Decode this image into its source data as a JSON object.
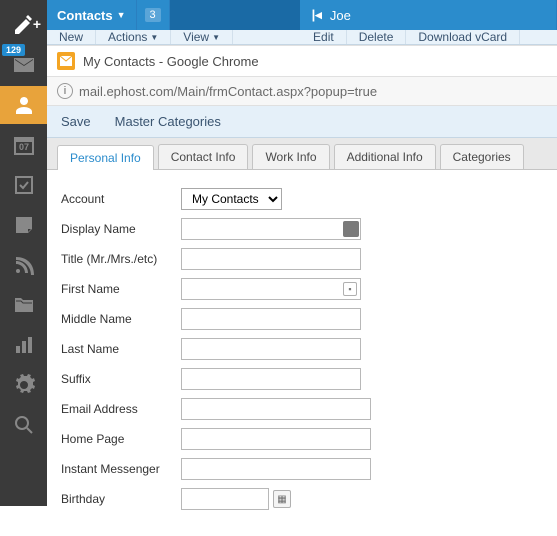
{
  "rail": {
    "mail_badge": "129",
    "calendar_day": "07"
  },
  "header": {
    "tab_contacts": "Contacts",
    "tab_count": "3",
    "tab_person": "Joe"
  },
  "toolbar_left": {
    "new": "New",
    "actions": "Actions",
    "view": "View"
  },
  "toolbar_right": {
    "edit": "Edit",
    "delete": "Delete",
    "download": "Download vCard"
  },
  "popup": {
    "title": "My Contacts - Google Chrome",
    "url": "mail.ephost.com/Main/frmContact.aspx?popup=true",
    "save": "Save",
    "master_categories": "Master Categories",
    "tabs": {
      "personal": "Personal Info",
      "contact": "Contact Info",
      "work": "Work Info",
      "additional": "Additional Info",
      "categories": "Categories"
    },
    "form": {
      "account_label": "Account",
      "account_value": "My Contacts",
      "display_name_label": "Display Name",
      "title_label": "Title (Mr./Mrs./etc)",
      "first_name_label": "First Name",
      "middle_name_label": "Middle Name",
      "last_name_label": "Last Name",
      "suffix_label": "Suffix",
      "email_label": "Email Address",
      "homepage_label": "Home Page",
      "im_label": "Instant Messenger",
      "birthday_label": "Birthday"
    }
  }
}
